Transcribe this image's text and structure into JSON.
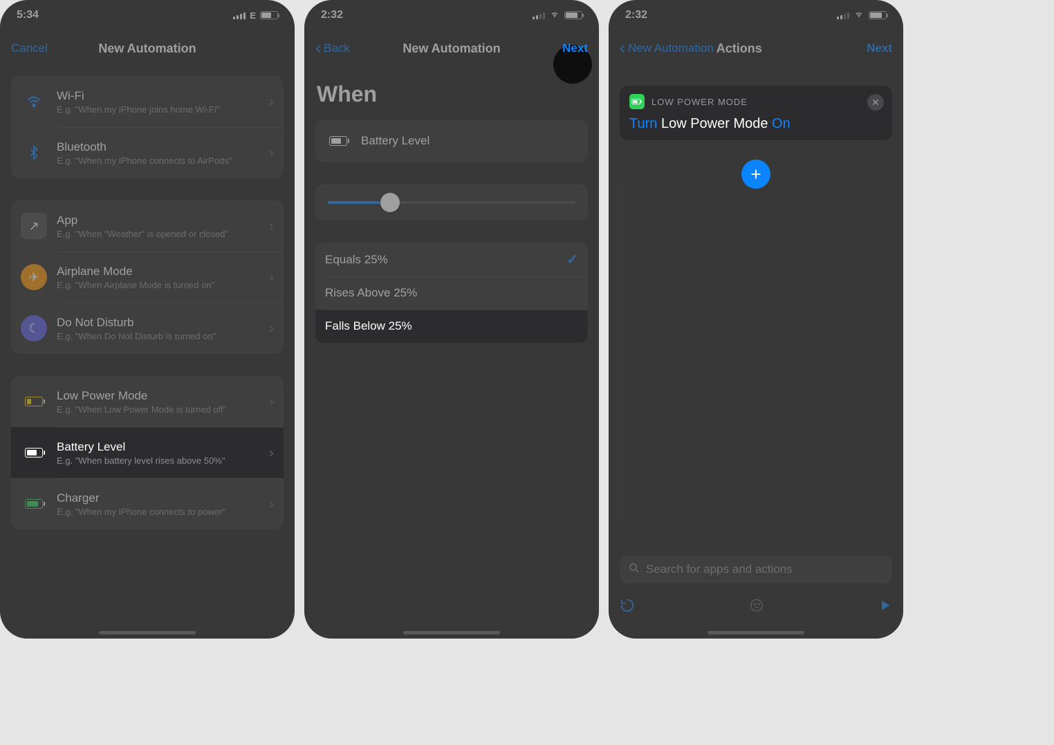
{
  "panel1": {
    "time": "5:34",
    "net_label": "E",
    "nav": {
      "cancel": "Cancel",
      "title": "New Automation"
    },
    "groups": [
      [
        {
          "icon": "wifi",
          "title": "Wi-Fi",
          "sub": "E.g. \"When my iPhone joins home Wi-Fi\""
        },
        {
          "icon": "bt",
          "title": "Bluetooth",
          "sub": "E.g. \"When my iPhone connects to AirPods\""
        }
      ],
      [
        {
          "icon": "app",
          "title": "App",
          "sub": "E.g. \"When \"Weather\" is opened or closed\""
        },
        {
          "icon": "air",
          "title": "Airplane Mode",
          "sub": "E.g. \"When Airplane Mode is turned on\""
        },
        {
          "icon": "dnd",
          "title": "Do Not Disturb",
          "sub": "E.g. \"When Do Not Disturb is turned on\""
        }
      ],
      [
        {
          "icon": "lpm",
          "title": "Low Power Mode",
          "sub": "E.g. \"When Low Power Mode is turned off\""
        },
        {
          "icon": "batt",
          "title": "Battery Level",
          "sub": "E.g. \"When battery level rises above 50%\"",
          "highlight": true
        },
        {
          "icon": "chg",
          "title": "Charger",
          "sub": "E.g. \"When my iPhone connects to power\""
        }
      ]
    ]
  },
  "panel2": {
    "time": "2:32",
    "nav": {
      "back": "Back",
      "title": "New Automation",
      "next": "Next"
    },
    "when": "When",
    "trigger_label": "Battery Level",
    "slider_percent": 25,
    "options": [
      {
        "label": "Equals 25%",
        "checked": true
      },
      {
        "label": "Rises Above 25%"
      },
      {
        "label": "Falls Below 25%",
        "highlight": true
      }
    ]
  },
  "panel3": {
    "time": "2:32",
    "nav": {
      "back": "New Automation",
      "title": "Actions",
      "next": "Next"
    },
    "action": {
      "header": "LOW POWER MODE",
      "turn": "Turn",
      "subject": "Low Power Mode",
      "state": "On"
    },
    "search_placeholder": "Search for apps and actions"
  }
}
